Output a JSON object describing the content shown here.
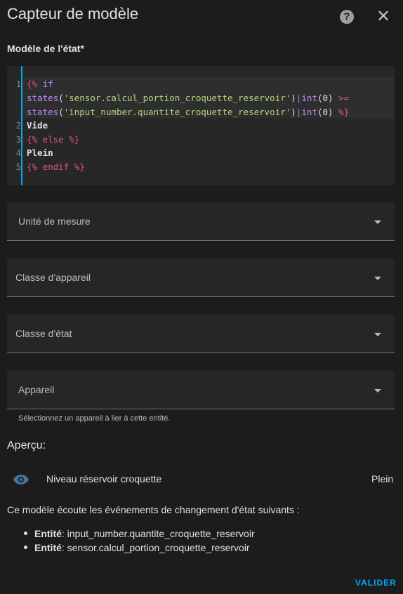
{
  "dialog": {
    "title": "Capteur de modèle",
    "help_icon": "help-circle-icon",
    "help_glyph": "?",
    "close_icon": "close-icon",
    "close_glyph": "✕"
  },
  "template_section": {
    "label": "Modèle de l'état*",
    "line_numbers": [
      "1",
      "2",
      "3",
      "4",
      "5"
    ],
    "lines": {
      "l1": {
        "open": "{%",
        "kw": " if"
      },
      "l1b": {
        "fn": "states",
        "p1": "(",
        "str": "'sensor.calcul_portion_croquette_reservoir'",
        "p2": ")",
        "bar": "|",
        "fn2": "int",
        "args": "(0)",
        "op": " >="
      },
      "l1c": {
        "fn": "states",
        "p1": "(",
        "str": "'input_number.quantite_croquette_reservoir'",
        "p2": ")",
        "bar": "|",
        "fn2": "int",
        "args": "(0)",
        "close": " %}"
      },
      "l2": "Vide",
      "l3": "{% else %}",
      "l4": "Plein",
      "l5": "{% endif %}"
    }
  },
  "fields": {
    "unit": {
      "label": "Unité de mesure"
    },
    "device_class": {
      "label": "Classe d'appareil"
    },
    "state_class": {
      "label": "Classe d'état"
    },
    "device": {
      "label": "Appareil",
      "helper": "Sélectionnez un appareil à lier à cette entité."
    }
  },
  "preview": {
    "title": "Aperçu:",
    "icon": "eye-icon",
    "entity_name": "Niveau réservoir croquette",
    "entity_state": "Plein",
    "listen_text": "Ce modèle écoute les événements de changement d'état suivants :",
    "entities": [
      {
        "label": "Entité",
        "value": ": input_number.quantite_croquette_reservoir"
      },
      {
        "label": "Entité",
        "value": ": sensor.calcul_portion_croquette_reservoir"
      }
    ]
  },
  "footer": {
    "validate_label": "VALIDER"
  },
  "colors": {
    "accent": "#03a9f4",
    "background": "#1c1c1c",
    "field": "#262626"
  }
}
